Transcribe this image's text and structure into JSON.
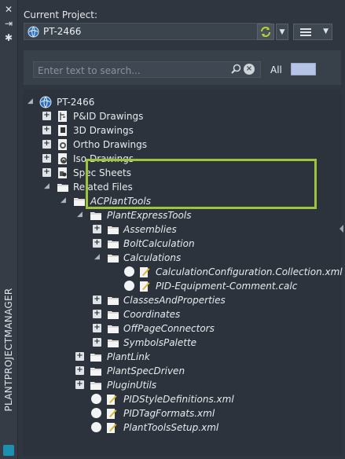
{
  "palette": {
    "title": "PLANTPROJECTMANAGER",
    "side_icons": [
      "close-icon",
      "pin-icon",
      "settings-icon"
    ]
  },
  "header": {
    "current_project_label": "Current Project:",
    "project_name": "PT-2466"
  },
  "search": {
    "placeholder": "Enter text to search...",
    "filter_label": "All"
  },
  "highlight_color": "#9cc43c",
  "tree": {
    "root": "PT-2466",
    "pid_drawings": "P&ID Drawings",
    "three_d_drawings": "3D Drawings",
    "ortho_drawings": "Ortho Drawings",
    "iso_drawings": "Iso Drawings",
    "spec_sheets": "Spec Sheets",
    "related_files": "Related Files",
    "acplanttools": "ACPlantTools",
    "plantexpresstools": "PlantExpressTools",
    "assemblies": "Assemblies",
    "boltcalculation": "BoltCalculation",
    "calculations": "Calculations",
    "calc_file_1": "CalculationConfiguration.Collection.xml",
    "calc_file_2": "PID-Equipment-Comment.calc",
    "classesandproperties": "ClassesAndProperties",
    "coordinates": "Coordinates",
    "offpageconnectors": "OffPageConnectors",
    "symbolspalette": "SymbolsPalette",
    "plantlink": "PlantLink",
    "plantspecdriven": "PlantSpecDriven",
    "pluginutils": "PluginUtils",
    "pidstyledefinitions": "PIDStyleDefinitions.xml",
    "pidtagformats": "PIDTagFormats.xml",
    "planttoolssetup": "PlantToolsSetup.xml"
  }
}
